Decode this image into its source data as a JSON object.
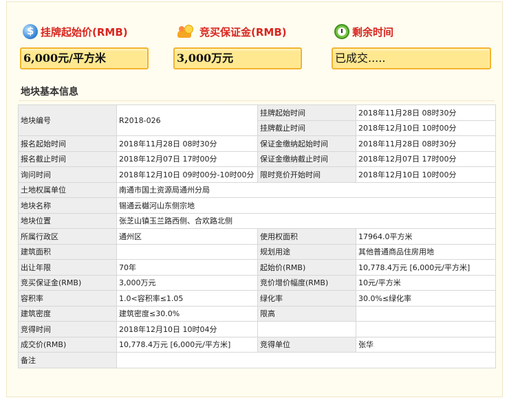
{
  "header": {
    "price_label": "挂牌起始价(RMB)",
    "price_value": "6,000元/平方米",
    "deposit_label": "竞买保证金(RMB)",
    "deposit_value": "3,000万元",
    "time_label": "剩余时间",
    "time_value": "已成交....."
  },
  "icons": {
    "price": "money-icon",
    "deposit": "coins-hand-icon",
    "time": "alarm-clock-icon"
  },
  "colors": {
    "label_red": "#d8261f",
    "box_fill": "#ffe890",
    "box_border": "#f4b32b"
  },
  "section_title": "地块基本信息",
  "info": {
    "parcel_no_label": "地块编号",
    "parcel_no": "R2018-026",
    "list_start_label": "挂牌起始时间",
    "list_start": "2018年11月28日 08时30分",
    "list_end_label": "挂牌截止时间",
    "list_end": "2018年12月10日 10时00分",
    "reg_start_label": "报名起始时间",
    "reg_start": "2018年11月28日 08时30分",
    "dep_start_label": "保证金缴纳起始时间",
    "dep_start": "2018年11月28日 08时30分",
    "reg_end_label": "报名截止时间",
    "reg_end": "2018年12月07日 17时00分",
    "dep_end_label": "保证金缴纳截止时间",
    "dep_end": "2018年12月07日 17时00分",
    "inquiry_label": "询问时间",
    "inquiry": "2018年12月10日 09时00分-10时00分",
    "timed_start_label": "限时竞价开始时间",
    "timed_start": "2018年12月10日 10时00分",
    "owner_label": "土地权属单位",
    "owner": "南通市国土资源局通州分局",
    "name_label": "地块名称",
    "name": "锡通云樾河山东侧宗地",
    "location_label": "地块位置",
    "location": "张芝山镇玉兰路西侧、合欢路北侧",
    "district_label": "所属行政区",
    "district": "通州区",
    "use_area_label": "使用权面积",
    "use_area": "17964.0平方米",
    "build_area_label": "建筑面积",
    "build_area": "",
    "plan_use_label": "规划用途",
    "plan_use": "其他普通商品住房用地",
    "term_label": "出让年限",
    "term": "70年",
    "start_price_label": "起始价(RMB)",
    "start_price": "10,778.4万元 [6,000元/平方米]",
    "deposit_label": "竞买保证金(RMB)",
    "deposit": "3,000万元",
    "increment_label": "竞价增价幅度(RMB)",
    "increment": "10元/平方米",
    "far_label": "容积率",
    "far": "1.0<容积率≤1.05",
    "green_label": "绿化率",
    "green": "30.0%≤绿化率",
    "density_label": "建筑密度",
    "density": "建筑密度≤30.0%",
    "height_label": "限高",
    "height": "",
    "win_time_label": "竞得时间",
    "win_time": "2018年12月10日 10时04分",
    "deal_price_label": "成交价(RMB)",
    "deal_price": "10,778.4万元 [6,000元/平方米]",
    "winner_label": "竞得单位",
    "winner": "张华",
    "remark_label": "备注",
    "remark": ""
  }
}
